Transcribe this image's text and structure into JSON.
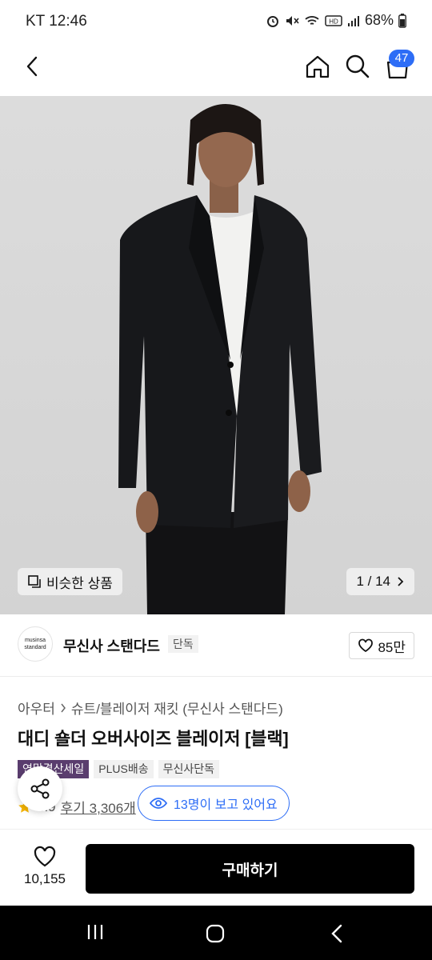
{
  "status": {
    "carrier_time": "KT 12:46",
    "battery": "68%"
  },
  "header": {
    "cart_count": "47"
  },
  "gallery": {
    "similar_label": "비슷한 상품",
    "pager": "1 / 14"
  },
  "brand": {
    "logo_line1": "musinsa",
    "logo_line2": "standard",
    "name": "무신사 스탠다드",
    "tag": "단독",
    "likes": "85만"
  },
  "product": {
    "category": "아우터",
    "subcategory": "슈트/블레이저 재킷 (무신사 스탠다드)",
    "title": "대디 숄더 오버사이즈 블레이저 [블랙]",
    "tags": [
      "연말결산세일",
      "PLUS배송",
      "무신사단독"
    ],
    "rating": "4.9",
    "reviews": "후기 3,306개"
  },
  "viewers": {
    "label": "13명이 보고 있어요"
  },
  "buy_bar": {
    "wish_count": "10,155",
    "buy_label": "구매하기"
  },
  "colors": {
    "accent": "#2d6df6",
    "sale_tag": "#5a3d6e"
  }
}
